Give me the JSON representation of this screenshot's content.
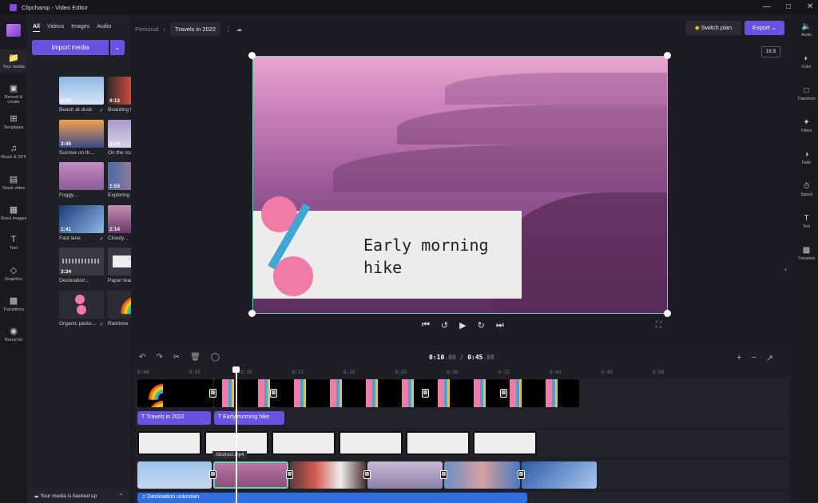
{
  "window": {
    "title": "Clipchamp - Video Editor"
  },
  "left_nav": [
    {
      "label": "Your media",
      "icon": "folder-icon"
    },
    {
      "label": "Record & create",
      "icon": "camera-icon"
    },
    {
      "label": "Templates",
      "icon": "grid-icon"
    },
    {
      "label": "Music & SFX",
      "icon": "music-icon"
    },
    {
      "label": "Stock video",
      "icon": "film-icon"
    },
    {
      "label": "Stock images",
      "icon": "image-icon"
    },
    {
      "label": "Text",
      "icon": "text-icon"
    },
    {
      "label": "Graphics",
      "icon": "shapes-icon"
    },
    {
      "label": "Transitions",
      "icon": "transition-icon"
    },
    {
      "label": "Brand kit",
      "icon": "brand-icon"
    }
  ],
  "media": {
    "tabs": [
      "All",
      "Videos",
      "Images",
      "Audio"
    ],
    "import_label": "Import media",
    "items": [
      {
        "name": "Beach at dusk",
        "duration": "0:15",
        "checked": true
      },
      {
        "name": "Boarding the...",
        "duration": "0:13",
        "checked": true
      },
      {
        "name": "Sunrise on th...",
        "duration": "3:45",
        "checked": false
      },
      {
        "name": "On the road",
        "duration": "0:16",
        "checked": true
      },
      {
        "name": "Foggy...",
        "duration": "",
        "checked": false
      },
      {
        "name": "Exploring the...",
        "duration": "1:53",
        "checked": true
      },
      {
        "name": "Fast lane",
        "duration": "1:41",
        "checked": true
      },
      {
        "name": "Cloudy...",
        "duration": "2:14",
        "checked": true
      },
      {
        "name": "Destination...",
        "duration": "3:34",
        "checked": false
      },
      {
        "name": "Paper tear",
        "duration": "",
        "checked": true
      },
      {
        "name": "Organic paste...",
        "duration": "",
        "checked": true
      },
      {
        "name": "Rainbow",
        "duration": "",
        "checked": true
      }
    ],
    "backup_status": "Your media is backed up"
  },
  "header": {
    "breadcrumb_root": "Personal",
    "project_name": "Travels in 2022",
    "switch_plan": "Switch plan",
    "export": "Export",
    "aspect_ratio": "16:9"
  },
  "preview": {
    "title_text_line1": "Early morning",
    "title_text_line2": "hike"
  },
  "right_panel": [
    {
      "label": "Audio"
    },
    {
      "label": "Color"
    },
    {
      "label": "Transform"
    },
    {
      "label": "Filters"
    },
    {
      "label": "Fade"
    },
    {
      "label": "Speed"
    },
    {
      "label": "Text"
    },
    {
      "label": "Transition"
    }
  ],
  "timeline": {
    "current": "0:10",
    "current_ms": ".00",
    "total": "0:45",
    "total_ms": ".00",
    "separator": "/",
    "ticks": [
      "0:00",
      "0:05",
      "0:10",
      "0:15",
      "0:20",
      "0:25",
      "0:30",
      "0:35",
      "0:40",
      "0:45",
      "0:50"
    ],
    "text_clips": [
      "Travels in 2022",
      "Early morning hike"
    ],
    "tooltip": "Abstract.mp4",
    "audio_clip": "Destination unknown"
  },
  "colors": {
    "accent": "#6a52e0",
    "audio": "#2f6fe0",
    "selection": "#6fd3b0"
  }
}
